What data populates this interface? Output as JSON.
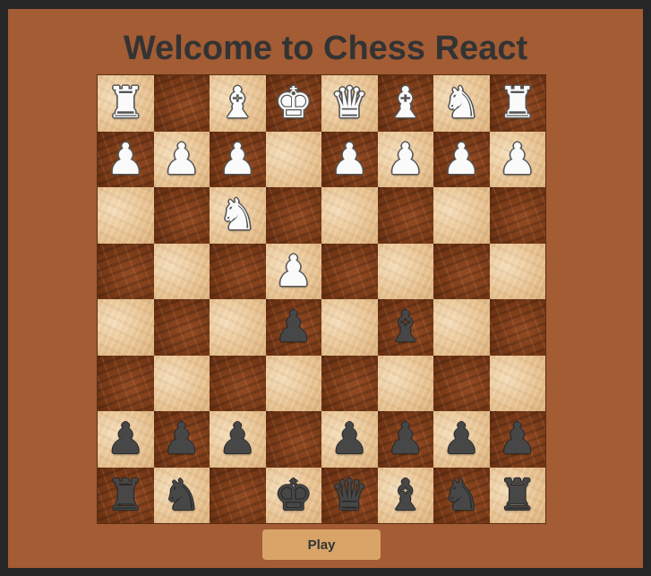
{
  "app": {
    "title": "Welcome to Chess React",
    "play_label": "Play"
  },
  "colors": {
    "frame": "#262626",
    "background": "#a35c34",
    "title_text": "#333333",
    "light_square": "#e8c79a",
    "dark_square": "#7a3d1a",
    "play_button": "#d8a468"
  },
  "board": {
    "orientation": "white-top",
    "rows": [
      [
        "wR",
        "",
        "wB",
        "wK",
        "wQ",
        "wB",
        "wN",
        "wR"
      ],
      [
        "wP",
        "wP",
        "wP",
        "",
        "wP",
        "wP",
        "wP",
        "wP"
      ],
      [
        "",
        "",
        "wN",
        "",
        "",
        "",
        "",
        ""
      ],
      [
        "",
        "",
        "",
        "wP",
        "",
        "",
        "",
        ""
      ],
      [
        "",
        "",
        "",
        "bP",
        "",
        "bB",
        "",
        ""
      ],
      [
        "",
        "",
        "",
        "",
        "",
        "",
        "",
        ""
      ],
      [
        "bP",
        "bP",
        "bP",
        "",
        "bP",
        "bP",
        "bP",
        "bP"
      ],
      [
        "bR",
        "bN",
        "",
        "bK",
        "bQ",
        "bB",
        "bN",
        "bR"
      ]
    ]
  }
}
